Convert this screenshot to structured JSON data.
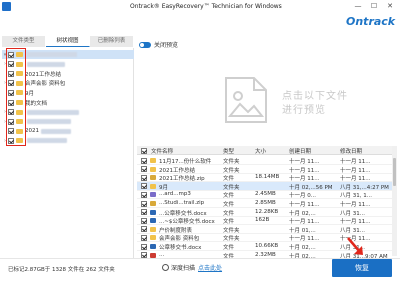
{
  "window": {
    "title": "Ontrack® EasyRecovery™ Technician for Windows",
    "minimize": "—",
    "maximize": "☐",
    "close": "✕"
  },
  "brand": "Ontrack",
  "tabs": [
    {
      "label": "文件类型",
      "active": false
    },
    {
      "label": "树状视图",
      "active": true
    },
    {
      "label": "已删除列表",
      "active": false
    }
  ],
  "tree": [
    {
      "label": "",
      "checked": true,
      "expander": "▾",
      "blurred": true
    },
    {
      "label": "",
      "checked": true,
      "expander": "›",
      "blurred": true
    },
    {
      "label": "2021工作总结",
      "checked": true,
      "expander": "",
      "blurred": false
    },
    {
      "label": "合声会影 资料包",
      "checked": true,
      "expander": "›",
      "blurred": false
    },
    {
      "label": "9月",
      "checked": true,
      "expander": "",
      "blurred": false
    },
    {
      "label": "我的文档",
      "checked": true,
      "expander": "",
      "blurred": false
    },
    {
      "label": "",
      "checked": true,
      "expander": "›",
      "blurred": true
    },
    {
      "label": "",
      "checked": true,
      "expander": "›",
      "blurred": true
    },
    {
      "label": "2021",
      "checked": true,
      "expander": "",
      "blurred": true
    },
    {
      "label": "",
      "checked": true,
      "expander": "›",
      "blurred": true
    }
  ],
  "preview": {
    "toggle_label": "关闭预览",
    "placeholder": "点击以下文件进行预览"
  },
  "grid": {
    "headers": [
      "文件名称",
      "类型",
      "大小",
      "创建日期",
      "修改日期"
    ],
    "rows": [
      {
        "name": "11月17...份什么软件",
        "type": "文件夹",
        "size": "",
        "created": "十一月 11...",
        "modified": "十一月 11...",
        "icon": "folder",
        "selected": false
      },
      {
        "name": "2021工作总结",
        "type": "文件夹",
        "size": "",
        "created": "十一月 11...",
        "modified": "十一月 11...",
        "icon": "folder",
        "selected": false
      },
      {
        "name": "2021工作总结.zip",
        "type": "文件",
        "size": "18.14MB",
        "created": "十一月 11...",
        "modified": "十一月 11...",
        "icon": "zip",
        "selected": false
      },
      {
        "name": "9月",
        "type": "文件夹",
        "size": "",
        "created": "十月 02,...56 PM",
        "modified": "八月 31,...4:27 PM",
        "icon": "folder",
        "selected": true
      },
      {
        "name": "...ard...mp3",
        "type": "文件",
        "size": "2.45MB",
        "created": "十一月 0...",
        "modified": "八月 31, 1...",
        "icon": "mp3",
        "selected": false
      },
      {
        "name": "...Studi...trail.zip",
        "type": "文件",
        "size": "2.85MB",
        "created": "十一月 11...",
        "modified": "十一月 11...",
        "icon": "zip",
        "selected": false
      },
      {
        "name": "...公章移交书.docx",
        "type": "文件",
        "size": "12.28KB",
        "created": "十月 02,...",
        "modified": "八月 31...",
        "icon": "doc",
        "selected": false
      },
      {
        "name": "...~$公章移交书.docx",
        "type": "文件",
        "size": "162B",
        "created": "十一月 11...",
        "modified": "十一月 11...",
        "icon": "doc",
        "selected": false
      },
      {
        "name": "户价制度附表",
        "type": "文件夹",
        "size": "",
        "created": "十月 01,...",
        "modified": "八月 31...",
        "icon": "folder",
        "selected": false
      },
      {
        "name": "会声会影 资料包",
        "type": "文件夹",
        "size": "",
        "created": "十一月 11...",
        "modified": "十一月 11...",
        "icon": "folder",
        "selected": false
      },
      {
        "name": "公章移交书.docx",
        "type": "文件",
        "size": "10.66KB",
        "created": "十月 02,...",
        "modified": "八月 31...",
        "icon": "doc",
        "selected": false
      },
      {
        "name": "...",
        "type": "文件",
        "size": "2.32MB",
        "created": "十月 02,...",
        "modified": "八月 31...9:07 AM",
        "icon": "pdf",
        "selected": false
      },
      {
        "name": "...",
        "type": "文件夹",
        "size": "",
        "created": "",
        "modified": "",
        "icon": "folder",
        "selected": false
      }
    ]
  },
  "footer": {
    "status": "已标记2.87GB于 1328 文件在 262 文件夹",
    "deep_scan_label": "深度扫描",
    "deep_scan_link": "点击此处",
    "recover_button": "恢复"
  },
  "colors": {
    "accent": "#1e75c6",
    "highlight": "#e0271c"
  }
}
